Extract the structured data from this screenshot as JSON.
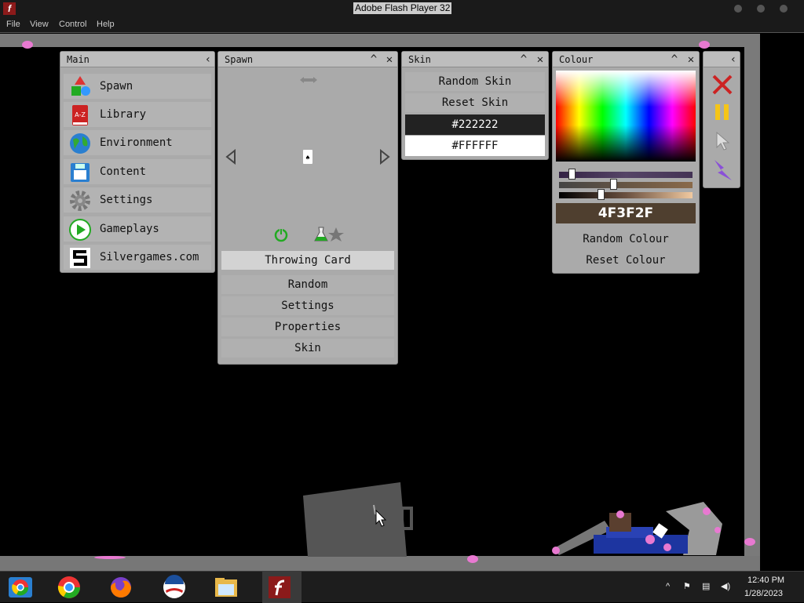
{
  "window": {
    "title": "Adobe Flash Player 32"
  },
  "menu": [
    "File",
    "View",
    "Control",
    "Help"
  ],
  "main_panel": {
    "title": "Main",
    "items": [
      "Spawn",
      "Library",
      "Environment",
      "Content",
      "Settings",
      "Gameplays",
      "Silvergames.com"
    ],
    "library_icon_text": "A-Z"
  },
  "spawn_panel": {
    "title": "Spawn",
    "selected": "Throwing Card",
    "buttons": [
      "Random",
      "Settings",
      "Properties",
      "Skin"
    ]
  },
  "skin_panel": {
    "title": "Skin",
    "buttons": [
      "Random Skin",
      "Reset Skin"
    ],
    "colors": [
      {
        "label": "#222222",
        "bg": "#222222",
        "fg": "#ffffff"
      },
      {
        "label": "#FFFFFF",
        "bg": "#ffffff",
        "fg": "#111111"
      }
    ]
  },
  "colour_panel": {
    "title": "Colour",
    "hex": "4F3F2F",
    "hex_bg": "#4F3F2F",
    "buttons": [
      "Random Colour",
      "Reset Colour"
    ]
  },
  "tools_panel": {
    "tools": [
      "close-tool-icon",
      "pause-icon",
      "cursor-icon",
      "lightning-icon"
    ]
  },
  "taskbar": {
    "apps": [
      "chrome-icon",
      "chrome-icon",
      "firefox-icon",
      "obama-logo-icon",
      "file-explorer-icon",
      "flash-player-icon"
    ],
    "time": "12:40 PM",
    "date": "1/28/2023"
  }
}
